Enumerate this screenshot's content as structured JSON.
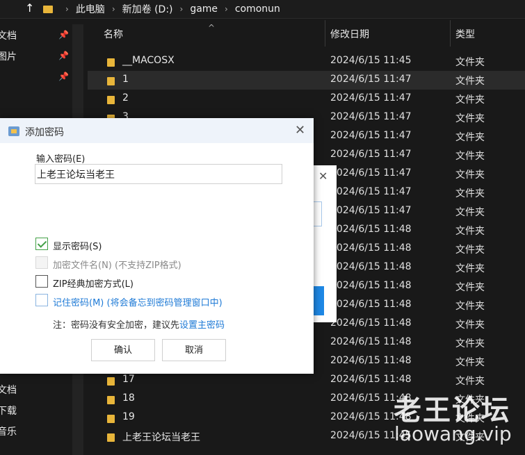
{
  "address": {
    "segments": [
      "此电脑",
      "新加卷 (D:)",
      "game",
      "comonun"
    ]
  },
  "nav": {
    "items_top": [
      "文档",
      "图片"
    ],
    "items_left": [
      "文档",
      "下载",
      "音乐"
    ]
  },
  "columns": {
    "name": "名称",
    "date": "修改日期",
    "type": "类型"
  },
  "rows": [
    {
      "name": "__MACOSX",
      "date": "2024/6/15 11:45",
      "type": "文件夹"
    },
    {
      "name": "1",
      "date": "2024/6/15 11:47",
      "type": "文件夹"
    },
    {
      "name": "2",
      "date": "2024/6/15 11:47",
      "type": "文件夹"
    },
    {
      "name": "3",
      "date": "2024/6/15 11:47",
      "type": "文件夹"
    },
    {
      "name": "",
      "date": "2024/6/15 11:47",
      "type": "文件夹"
    },
    {
      "name": "",
      "date": "2024/6/15 11:47",
      "type": "文件夹"
    },
    {
      "name": "",
      "date": "2024/6/15 11:47",
      "type": "文件夹"
    },
    {
      "name": "",
      "date": "2024/6/15 11:47",
      "type": "文件夹"
    },
    {
      "name": "",
      "date": "2024/6/15 11:47",
      "type": "文件夹"
    },
    {
      "name": "",
      "date": "2024/6/15 11:48",
      "type": "文件夹"
    },
    {
      "name": "",
      "date": "2024/6/15 11:48",
      "type": "文件夹"
    },
    {
      "name": "",
      "date": "2024/6/15 11:48",
      "type": "文件夹"
    },
    {
      "name": "",
      "date": "2024/6/15 11:48",
      "type": "文件夹"
    },
    {
      "name": "",
      "date": "2024/6/15 11:48",
      "type": "文件夹"
    },
    {
      "name": "",
      "date": "2024/6/15 11:48",
      "type": "文件夹"
    },
    {
      "name": "",
      "date": "2024/6/15 11:48",
      "type": "文件夹"
    },
    {
      "name": "",
      "date": "2024/6/15 11:48",
      "type": "文件夹"
    },
    {
      "name": "17",
      "date": "2024/6/15 11:48",
      "type": "文件夹"
    },
    {
      "name": "18",
      "date": "2024/6/15 11:48",
      "type": "文件夹"
    },
    {
      "name": "19",
      "date": "2024/6/15 11:48",
      "type": "文件夹"
    },
    {
      "name": "上老王论坛当老王",
      "date": "2024/6/15 11:45",
      "type": "文件夹"
    }
  ],
  "dialog": {
    "title": "添加密码",
    "password_label": "输入密码(E)",
    "password_value": "上老王论坛当老王",
    "options": [
      {
        "label": "显示密码(S)",
        "state": "checked"
      },
      {
        "label": "加密文件名(N) (不支持ZIP格式)",
        "state": "disabled"
      },
      {
        "label": "ZIP经典加密方式(L)",
        "state": "unchecked"
      },
      {
        "label": "记住密码(M) (将会备忘到密码管理窗口中)",
        "state": "unchecked"
      }
    ],
    "note_prefix": "注：密码没有安全加密，建议先",
    "note_link": "设置主密码",
    "ok_label": "确认",
    "cancel_label": "取消"
  },
  "watermark": {
    "line1": "老王论坛",
    "line2": "laowang.vip"
  }
}
